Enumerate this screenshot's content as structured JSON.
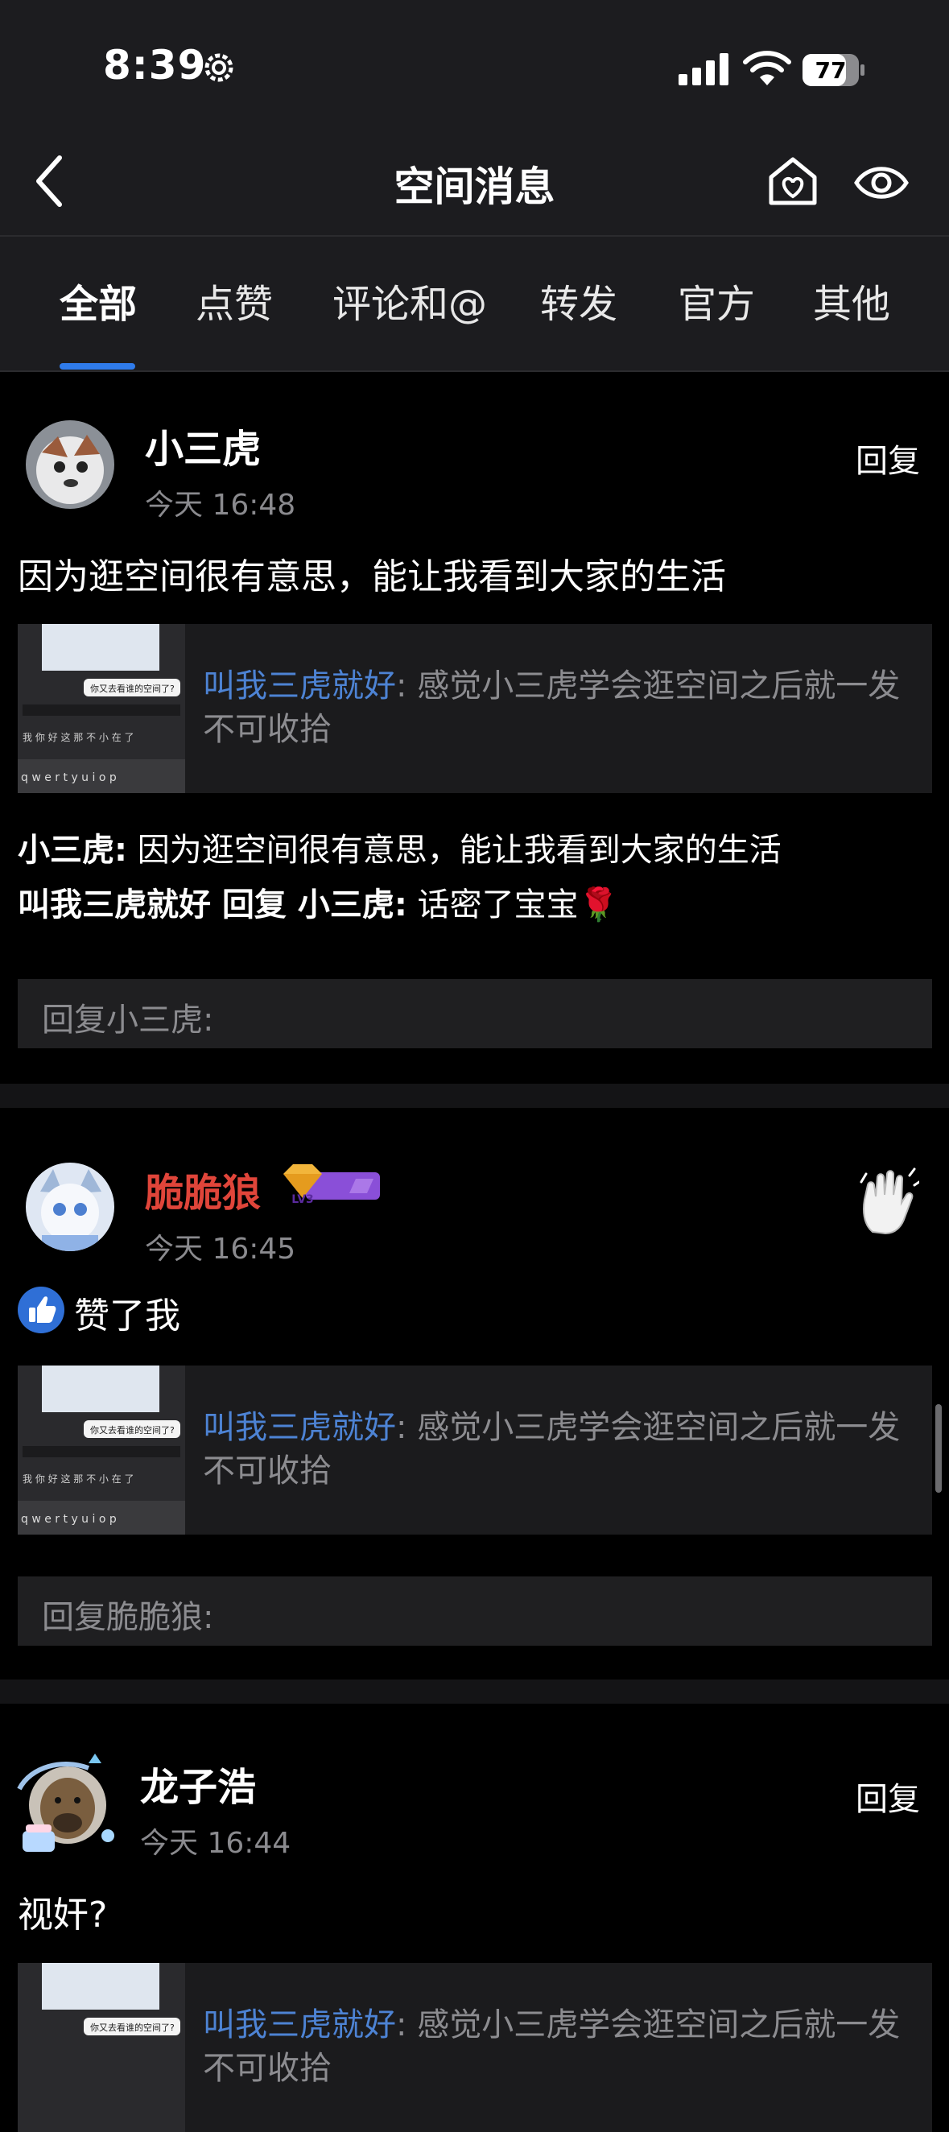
{
  "status_bar": {
    "time": "8:39",
    "battery": "77"
  },
  "nav": {
    "title": "空间消息",
    "back_icon": "chevron-left-icon",
    "home_icon": "home-heart-icon",
    "eye_icon": "eye-icon"
  },
  "tabs": [
    {
      "label": "全部",
      "active": true
    },
    {
      "label": "点赞"
    },
    {
      "label": "评论和@"
    },
    {
      "label": "转发"
    },
    {
      "label": "官方"
    },
    {
      "label": "其他"
    }
  ],
  "notifications": [
    {
      "user": "小三虎",
      "time": "今天 16:48",
      "action_label": "回复",
      "message": "因为逛空间很有意思，能让我看到大家的生活",
      "quote": {
        "author": "叫我三虎就好",
        "text": ": 感觉小三虎学会逛空间之后就一发不可收拾"
      },
      "thread": [
        {
          "speaker": "小三虎:",
          "text": " 因为逛空间很有意思，能让我看到大家的生活"
        },
        {
          "speaker": "叫我三虎就好 回复 小三虎:",
          "text": " 话密了宝宝🌹"
        }
      ],
      "reply_placeholder": "回复小三虎:"
    },
    {
      "user": "脆脆狼",
      "user_color": "#e0453a",
      "badge": "LV3",
      "time": "今天 16:45",
      "action_icon": "wave-hand-icon",
      "message": "赞了我",
      "message_icon": "thumbs-up-icon",
      "quote": {
        "author": "叫我三虎就好",
        "text": ": 感觉小三虎学会逛空间之后就一发不可收拾"
      },
      "reply_placeholder": "回复脆脆狼:"
    },
    {
      "user": "龙子浩",
      "time": "今天 16:44",
      "action_label": "回复",
      "message": "视奸?",
      "quote": {
        "author": "叫我三虎就好",
        "text": ": 感觉小三虎学会逛空间之后就一发不可收拾"
      }
    }
  ],
  "thumb": {
    "bubble_text": "你又去看谁的空间了?",
    "keyboard_row1": "我 你 好 这 那 不 小 在 了",
    "keyboard_row2": "q w e r t y u i o p"
  },
  "colors": {
    "accent": "#2f7bea",
    "link": "#4d83d4",
    "bar_bg": "#1c1c1f"
  }
}
